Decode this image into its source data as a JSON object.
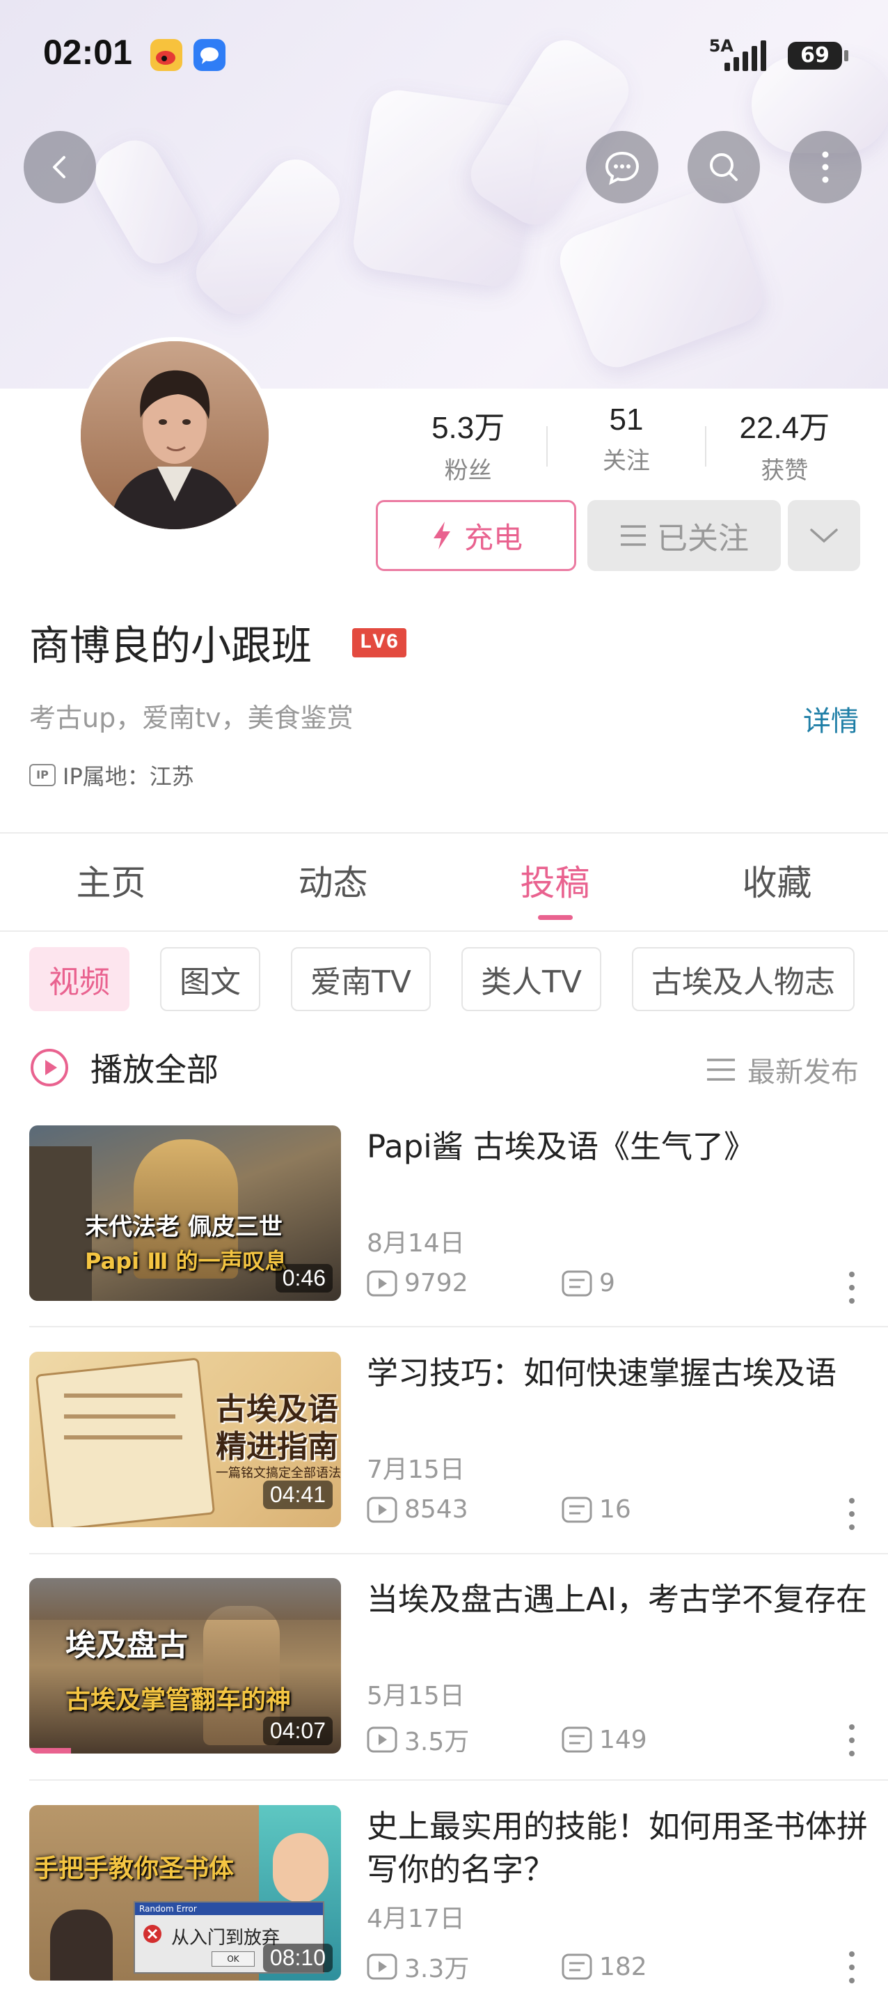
{
  "status": {
    "time": "02:01",
    "network": "5A",
    "battery": "69"
  },
  "profile": {
    "name": "商博良的小跟班",
    "level": "LV6",
    "bio": "考古up，爱南tv，美食鉴赏",
    "detail_label": "详情",
    "ip": "IP属地：江苏",
    "stats": [
      {
        "value": "5.3万",
        "label": "粉丝"
      },
      {
        "value": "51",
        "label": "关注"
      },
      {
        "value": "22.4万",
        "label": "获赞"
      }
    ],
    "charge_label": "充电",
    "follow_label": "已关注"
  },
  "tabs": [
    "主页",
    "动态",
    "投稿",
    "收藏"
  ],
  "active_tab": "投稿",
  "chips": [
    "视频",
    "图文",
    "爱南TV",
    "类人TV",
    "古埃及人物志"
  ],
  "play_all": "播放全部",
  "sort_label": "最新发布",
  "videos": [
    {
      "title": "Papi酱 古埃及语《生气了》",
      "date": "8月14日",
      "views": "9792",
      "comments": "9",
      "duration": "0:46",
      "caption1": "末代法老 佩皮三世",
      "caption2": "Papi Ⅲ 的一声叹息"
    },
    {
      "title": "学习技巧：如何快速掌握古埃及语",
      "date": "7月15日",
      "views": "8543",
      "comments": "16",
      "duration": "04:41",
      "caption1": "古埃及语",
      "caption2": "精进指南",
      "caption3": "一篇铭文搞定全部语法"
    },
    {
      "title": "当埃及盘古遇上AI，考古学不复存在",
      "date": "5月15日",
      "views": "3.5万",
      "comments": "149",
      "duration": "04:07",
      "caption1": "埃及盘古",
      "caption2": "古埃及掌管翻车的神"
    },
    {
      "title": "史上最实用的技能！如何用圣书体拼写你的名字？",
      "date": "4月17日",
      "views": "3.3万",
      "comments": "182",
      "duration": "08:10",
      "caption1": "手把手教你圣书体",
      "caption2": "从入门到放弃",
      "caption3": "Random Error",
      "caption4": "OK"
    }
  ],
  "colors": {
    "accent": "#e9628f",
    "link": "#1e7ea6",
    "level": "#e34a3f"
  }
}
